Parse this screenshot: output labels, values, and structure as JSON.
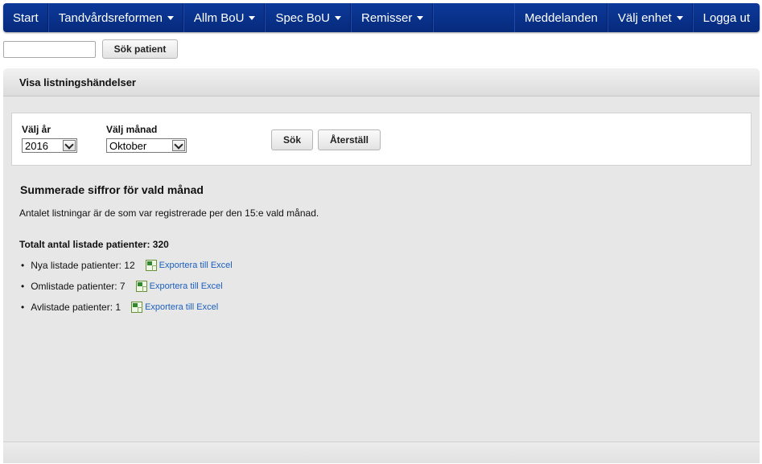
{
  "nav": {
    "items": [
      {
        "label": "Start",
        "dropdown": false
      },
      {
        "label": "Tandvårdsreformen",
        "dropdown": true
      },
      {
        "label": "Allm BoU",
        "dropdown": true
      },
      {
        "label": "Spec BoU",
        "dropdown": true
      },
      {
        "label": "Remisser",
        "dropdown": true
      }
    ],
    "right_items": [
      {
        "label": "Meddelanden",
        "dropdown": false
      },
      {
        "label": "Välj enhet",
        "dropdown": true
      },
      {
        "label": "Logga ut",
        "dropdown": false
      }
    ],
    "color": "#0a3590"
  },
  "search": {
    "input_value": "",
    "button_label": "Sök patient"
  },
  "panel": {
    "title": "Visa listningshändelser",
    "filters": {
      "year_label": "Välj år",
      "year_value": "2016",
      "month_label": "Välj månad",
      "month_value": "Oktober",
      "search_button": "Sök",
      "reset_button": "Återställ"
    },
    "summary": {
      "title": "Summerade siffror för vald månad",
      "description": "Antalet listningar är de som var registrerade per den 15:e vald månad.",
      "total": "Totalt antal listade patienter: 320",
      "items": [
        {
          "label": "Nya listade patienter: 12",
          "link": "Exportera till Excel"
        },
        {
          "label": "Omlistade patienter: 7",
          "link": "Exportera till Excel"
        },
        {
          "label": "Avlistade patienter: 1",
          "link": "Exportera till Excel"
        }
      ]
    }
  }
}
